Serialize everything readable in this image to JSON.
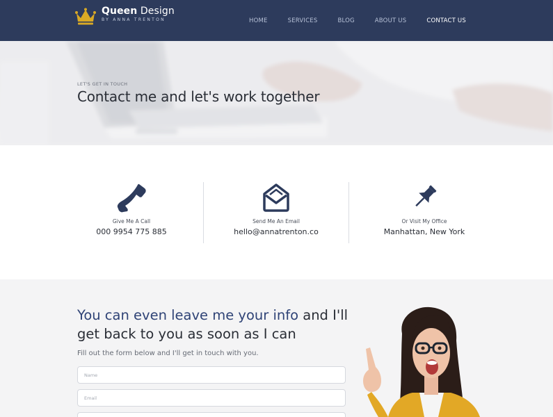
{
  "brand": {
    "name_bold": "Queen",
    "name_rest": " Design",
    "byline": "BY ANNA TRENTON",
    "crown_color": "#d9a925"
  },
  "nav": {
    "items": [
      {
        "label": "HOME"
      },
      {
        "label": "SERVICES"
      },
      {
        "label": "BLOG"
      },
      {
        "label": "ABOUT US"
      },
      {
        "label": "CONTACT US"
      }
    ],
    "active": "CONTACT US",
    "background": "#2d3b5c"
  },
  "hero": {
    "kicker": "LET'S GET IN TOUCH",
    "title": "Contact me and let's work together"
  },
  "contact": {
    "items": [
      {
        "icon": "phone-icon",
        "label": "Give Me A Call",
        "value": "000 9954 775 885"
      },
      {
        "icon": "envelope-icon",
        "label": "Send Me An Email",
        "value": "hello@annatrenton.co"
      },
      {
        "icon": "pin-icon",
        "label": "Or Visit My Office",
        "value": "Manhattan, New York"
      }
    ],
    "icon_color": "#2d3b5c"
  },
  "form": {
    "heading_accent": "You can even leave me your info",
    "heading_rest": " and I'll get back to you as soon as I can",
    "description": "Fill out the form below and I'll get in touch with you.",
    "fields": [
      {
        "placeholder": "Name"
      },
      {
        "placeholder": "Email"
      },
      {
        "placeholder": ""
      }
    ]
  }
}
